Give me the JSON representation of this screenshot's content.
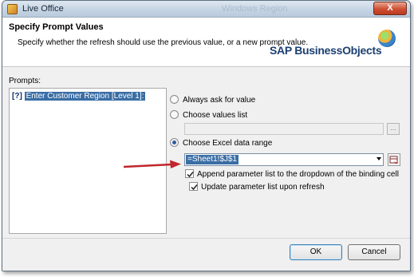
{
  "window": {
    "title": "Live Office",
    "faint_background_title": "Windows Region",
    "close_label": "X"
  },
  "header": {
    "title": "Specify Prompt Values",
    "description": "Specify whether the refresh should use the previous value, or a new prompt value.",
    "brand": "SAP BusinessObjects"
  },
  "prompts": {
    "label": "Prompts:",
    "items": [
      {
        "marker": "[?]",
        "text": "Enter Customer Region [Level 1]:"
      }
    ]
  },
  "options": {
    "always_ask": {
      "label": "Always ask for value",
      "selected": false
    },
    "choose_values": {
      "label": "Choose values list",
      "selected": false,
      "value": "",
      "browse_label": "..."
    },
    "excel_range": {
      "label": "Choose Excel data range",
      "selected": true,
      "value": "=Sheet1!$J$1"
    },
    "append_param": {
      "label": "Append parameter list to the dropdown of the binding cell",
      "checked": true
    },
    "update_param": {
      "label": "Update parameter list upon refresh",
      "checked": true
    }
  },
  "buttons": {
    "ok": "OK",
    "cancel": "Cancel"
  },
  "colors": {
    "selection": "#3a6ea5",
    "annotation_arrow": "#c0272d",
    "brand": "#1b3f72"
  }
}
